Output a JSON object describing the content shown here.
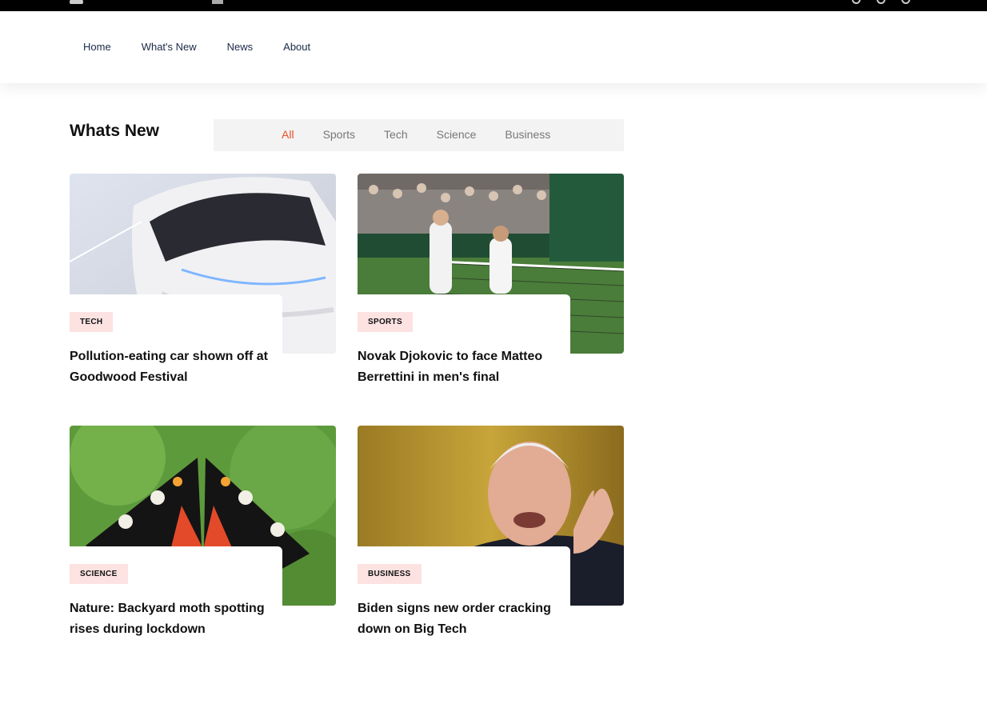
{
  "topbar": {
    "user_icon": "user-icon",
    "date_icon": "calendar-icon",
    "social_icons": [
      "globe-icon",
      "instagram-icon",
      "link-icon"
    ]
  },
  "nav": {
    "items": [
      "Home",
      "What's New",
      "News",
      "About"
    ]
  },
  "section": {
    "title": "Whats New",
    "filters": [
      "All",
      "Sports",
      "Tech",
      "Science",
      "Business"
    ],
    "active_filter": "All",
    "accent_color": "#e8512c"
  },
  "cards": [
    {
      "tag": "TECH",
      "title": "Pollution-eating car shown off at Goodwood Festival"
    },
    {
      "tag": "SPORTS",
      "title": "Novak Djokovic to face Matteo Berrettini in men's final"
    },
    {
      "tag": "SCIENCE",
      "title": "Nature: Backyard moth spotting rises during lockdown"
    },
    {
      "tag": "BUSINESS",
      "title": "Biden signs new order cracking down on Big Tech"
    }
  ]
}
